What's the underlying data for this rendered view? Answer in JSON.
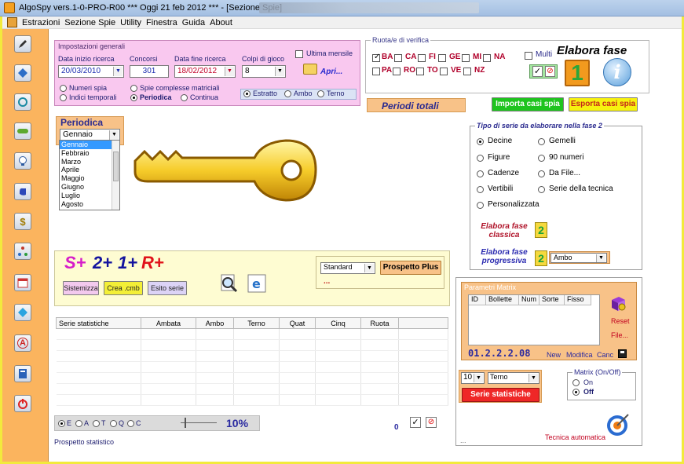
{
  "window": {
    "title": "AlgoSpy vers.1-0-PRO-R00  ***  Oggi 21 feb 2012  ***   - [Sezione Spie]"
  },
  "menu": [
    "Estrazioni",
    "Sezione Spie",
    "Utility",
    "Finestra",
    "Guida",
    "About"
  ],
  "toolbar_icons": [
    "pencil-icon",
    "diamond-icon",
    "refresh-icon",
    "pill-icon",
    "lightbulb-icon",
    "hand-icon",
    "dollar-icon",
    "network-icon",
    "calendar-icon",
    "shape-icon",
    "letter-a-icon",
    "book-icon",
    "power-icon"
  ],
  "impostazioni": {
    "legend": "Impostazioni generali",
    "data_inizio_label": "Data inizio ricerca",
    "data_inizio": "20/03/2010",
    "concorsi_label": "Concorsi",
    "concorsi": "301",
    "data_fine_label": "Data fine ricerca",
    "data_fine": "18/02/2012",
    "colpi_label": "Colpi di gioco",
    "colpi": "8",
    "ultima_mensile": "Ultima mensile",
    "apri": "Apri...",
    "numeri_spia": "Numeri spia",
    "indici_temporali": "Indici temporali",
    "spie_complesse": "Spie complesse matriciali",
    "periodica": "Periodica",
    "continua": "Continua",
    "estratto": "Estratto",
    "ambo": "Ambo",
    "terno": "Terno"
  },
  "ruota": {
    "legend": "Ruota/e di verifica",
    "row1": [
      "BA",
      "CA",
      "FI",
      "GE",
      "MI",
      "NA"
    ],
    "row2": [
      "PA",
      "RO",
      "TO",
      "VE",
      "NZ"
    ],
    "multi": "Multi",
    "elabora_fase": "Elabora fase",
    "fase_number": "1"
  },
  "periodi_totali": "Periodi totali",
  "importa": "Importa casi spia",
  "esporta": "Esporta casi spia",
  "periodica_panel": {
    "title": "Periodica",
    "selected": "Gennaio",
    "months": [
      "Gennaio",
      "Febbraio",
      "Marzo",
      "Aprile",
      "Maggio",
      "Giugno",
      "Luglio",
      "Agosto"
    ]
  },
  "tipo_serie": {
    "legend": "Tipo di serie da elaborare nella fase 2",
    "left": [
      "Decine",
      "Figure",
      "Cadenze",
      "Vertibili",
      "Personalizzata"
    ],
    "right": [
      "Gemelli",
      "90 numeri",
      "Da File...",
      "Serie della tecnica"
    ],
    "elabora_classica": "Elabora fase classica",
    "elabora_progressiva": "Elabora fase progressiva",
    "progressiva_select": "Ambo",
    "fase_number": "2"
  },
  "sistemazione": {
    "s_plus": "S+",
    "two_plus": "2+",
    "one_plus": "1+",
    "r_plus": "R+",
    "sistemizza": "Sistemizza",
    "crea_cmb": "Crea .cmb",
    "esito_serie": "Esito serie",
    "standard": "Standard",
    "prospetto_plus": "Prospetto Plus",
    "dots": "..."
  },
  "stat_table": {
    "headers": [
      "Serie statistiche",
      "Ambata",
      "Ambo",
      "Terno",
      "Quat",
      "Cinq",
      "Ruota",
      ""
    ]
  },
  "matrix": {
    "legend": "Parametri Matrix",
    "headers": [
      "ID",
      "Bollette",
      "Num",
      "Sorte",
      "Fisso"
    ],
    "code": "01.2.2.2.08",
    "reset": "Reset",
    "file": "File...",
    "new": "New",
    "modifica": "Modifica",
    "canc": "Canc"
  },
  "serie_controls": {
    "count": "10",
    "sorte": "Terno",
    "serie_statistiche": "Serie statistiche"
  },
  "matrix_onoff": {
    "legend": "Matrix (On/Off)",
    "on": "On",
    "off": "Off"
  },
  "status": {
    "radios": [
      "E",
      "A",
      "T",
      "Q",
      "C"
    ],
    "percent": "10%",
    "percent_value": 0.1,
    "zero": "0",
    "prospetto_statistico": "Prospetto statistico",
    "tecnica_automatica": "Tecnica automatica",
    "dots": "..."
  }
}
